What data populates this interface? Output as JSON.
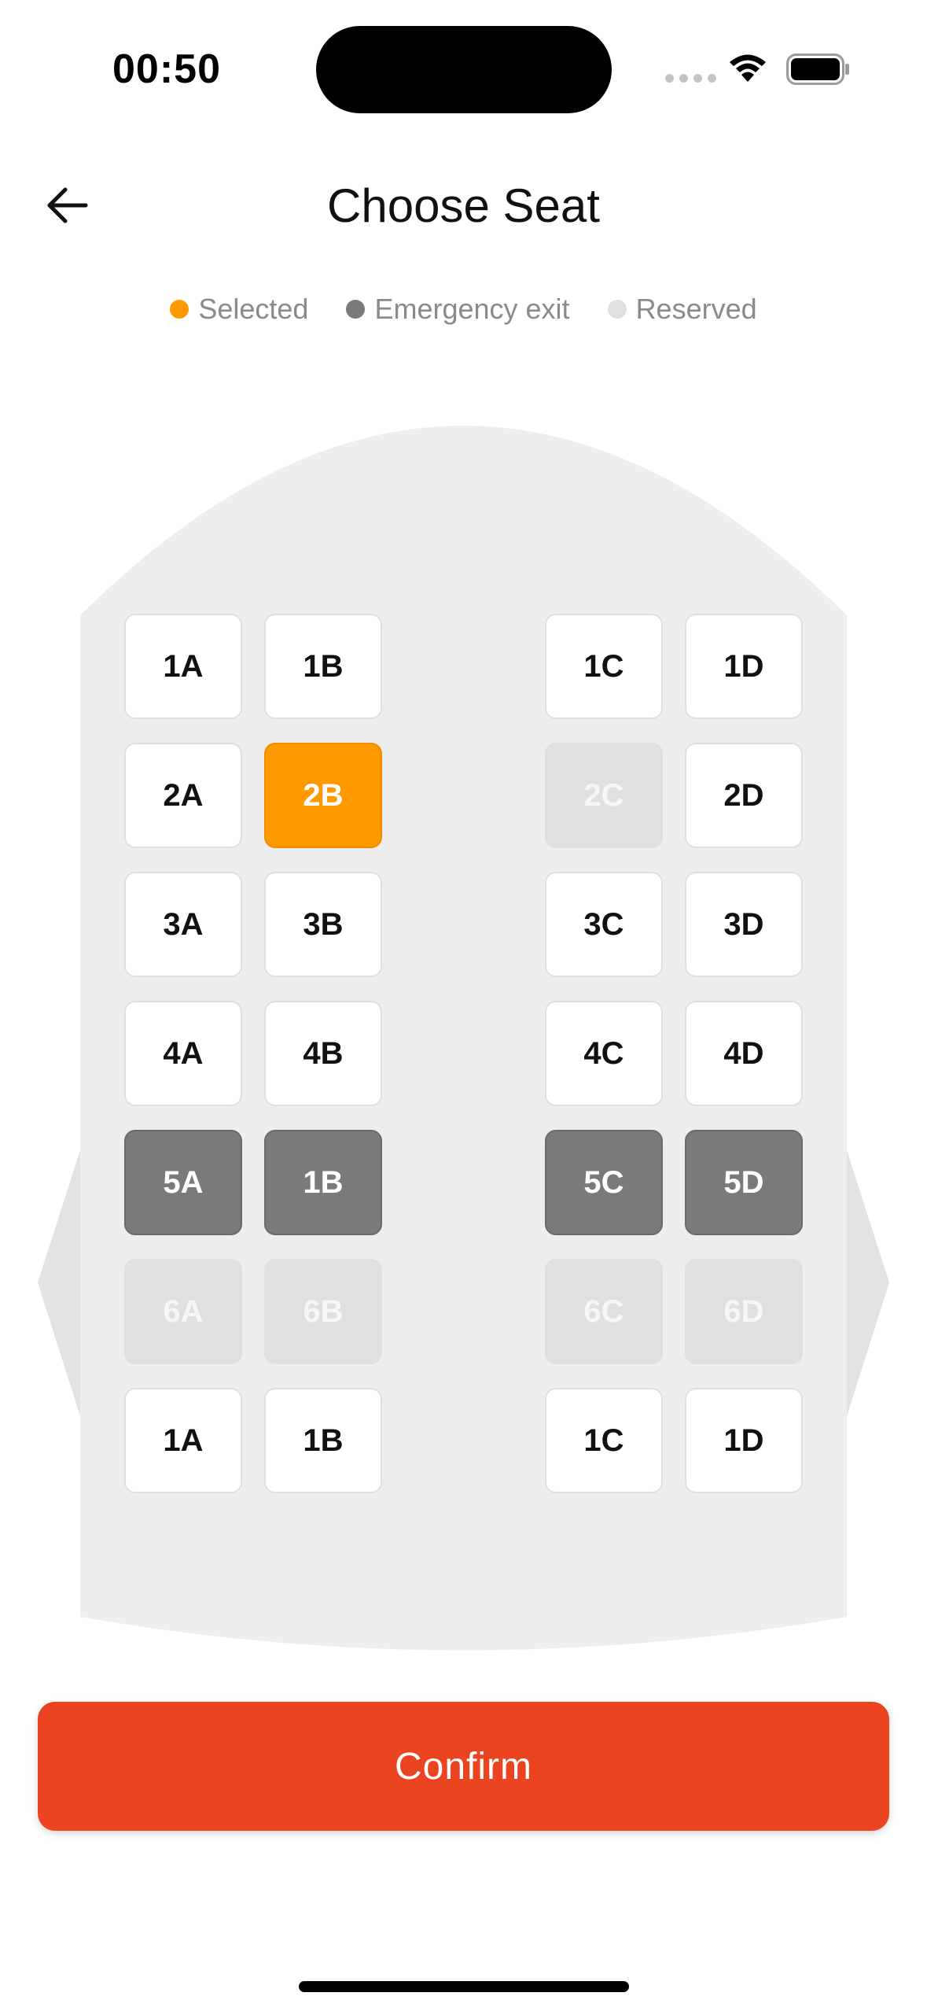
{
  "status_bar": {
    "time": "00:50",
    "wifi_icon": "wifi-icon",
    "battery_icon": "battery-icon"
  },
  "header": {
    "title": "Choose Seat",
    "back_icon": "arrow-left-icon"
  },
  "legend": [
    {
      "label": "Selected",
      "color": "#fe9a00"
    },
    {
      "label": "Emergency exit",
      "color": "#7a7a7a"
    },
    {
      "label": "Reserved",
      "color": "#e0e0e0"
    }
  ],
  "seats": {
    "rows": [
      [
        {
          "label": "1A",
          "state": "available"
        },
        {
          "label": "1B",
          "state": "available"
        },
        {
          "label": "1C",
          "state": "available"
        },
        {
          "label": "1D",
          "state": "available"
        }
      ],
      [
        {
          "label": "2A",
          "state": "available"
        },
        {
          "label": "2B",
          "state": "selected"
        },
        {
          "label": "2C",
          "state": "reserved"
        },
        {
          "label": "2D",
          "state": "available"
        }
      ],
      [
        {
          "label": "3A",
          "state": "available"
        },
        {
          "label": "3B",
          "state": "available"
        },
        {
          "label": "3C",
          "state": "available"
        },
        {
          "label": "3D",
          "state": "available"
        }
      ],
      [
        {
          "label": "4A",
          "state": "available"
        },
        {
          "label": "4B",
          "state": "available"
        },
        {
          "label": "4C",
          "state": "available"
        },
        {
          "label": "4D",
          "state": "available"
        }
      ],
      [
        {
          "label": "5A",
          "state": "exit"
        },
        {
          "label": "1B",
          "state": "exit"
        },
        {
          "label": "5C",
          "state": "exit"
        },
        {
          "label": "5D",
          "state": "exit"
        }
      ],
      [
        {
          "label": "6A",
          "state": "reserved"
        },
        {
          "label": "6B",
          "state": "reserved"
        },
        {
          "label": "6C",
          "state": "reserved"
        },
        {
          "label": "6D",
          "state": "reserved"
        }
      ],
      [
        {
          "label": "1A",
          "state": "available"
        },
        {
          "label": "1B",
          "state": "available"
        },
        {
          "label": "1C",
          "state": "available"
        },
        {
          "label": "1D",
          "state": "available"
        }
      ]
    ]
  },
  "confirm": {
    "label": "Confirm",
    "color": "#ea4421"
  }
}
